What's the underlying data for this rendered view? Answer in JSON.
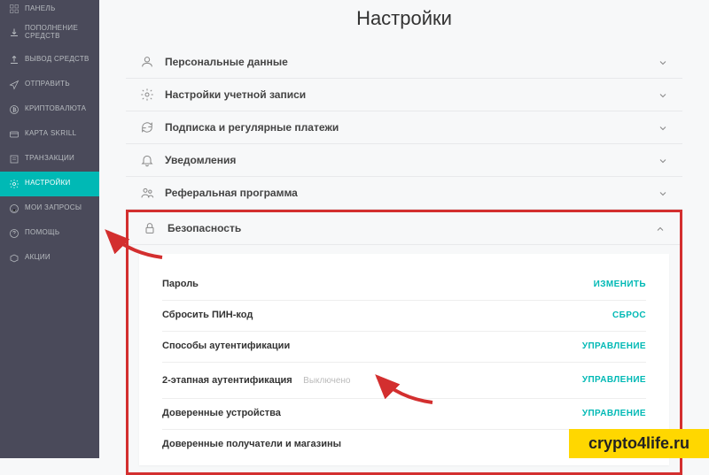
{
  "page_title": "Настройки",
  "sidebar": {
    "items": [
      {
        "label": "ПАНЕЛЬ",
        "icon": "dashboard-icon"
      },
      {
        "label": "ПОПОЛНЕНИЕ СРЕДСТВ",
        "icon": "deposit-icon"
      },
      {
        "label": "ВЫВОД СРЕДСТВ",
        "icon": "withdraw-icon"
      },
      {
        "label": "ОТПРАВИТЬ",
        "icon": "send-icon"
      },
      {
        "label": "КРИПТОВАЛЮТА",
        "icon": "crypto-icon"
      },
      {
        "label": "КАРТА SKRILL",
        "icon": "card-icon"
      },
      {
        "label": "ТРАНЗАКЦИИ",
        "icon": "transactions-icon"
      },
      {
        "label": "НАСТРОЙКИ",
        "icon": "gear-icon",
        "active": true
      },
      {
        "label": "МОИ ЗАПРОСЫ",
        "icon": "support-icon"
      },
      {
        "label": "ПОМОЩЬ",
        "icon": "help-icon"
      },
      {
        "label": "АКЦИИ",
        "icon": "promo-icon"
      }
    ]
  },
  "sections": [
    {
      "label": "Персональные данные",
      "icon": "person-icon"
    },
    {
      "label": "Настройки учетной записи",
      "icon": "gear-icon"
    },
    {
      "label": "Подписка и регулярные платежи",
      "icon": "refresh-icon"
    },
    {
      "label": "Уведомления",
      "icon": "bell-icon"
    },
    {
      "label": "Реферальная программа",
      "icon": "users-icon"
    }
  ],
  "security": {
    "label": "Безопасность",
    "rows": [
      {
        "label": "Пароль",
        "action": "ИЗМЕНИТЬ"
      },
      {
        "label": "Сбросить ПИН-код",
        "action": "СБРОС"
      },
      {
        "label": "Способы аутентификации",
        "action": "УПРАВЛЕНИЕ"
      },
      {
        "label": "2-этапная аутентификация",
        "sub": "Выключено",
        "action": "УПРАВЛЕНИЕ"
      },
      {
        "label": "Доверенные устройства",
        "action": "УПРАВЛЕНИЕ"
      },
      {
        "label": "Доверенные получатели и магазины",
        "action": ""
      }
    ]
  },
  "watermark": "crypto4life.ru",
  "colors": {
    "accent": "#00b9b5",
    "highlight": "#d32f2f"
  }
}
